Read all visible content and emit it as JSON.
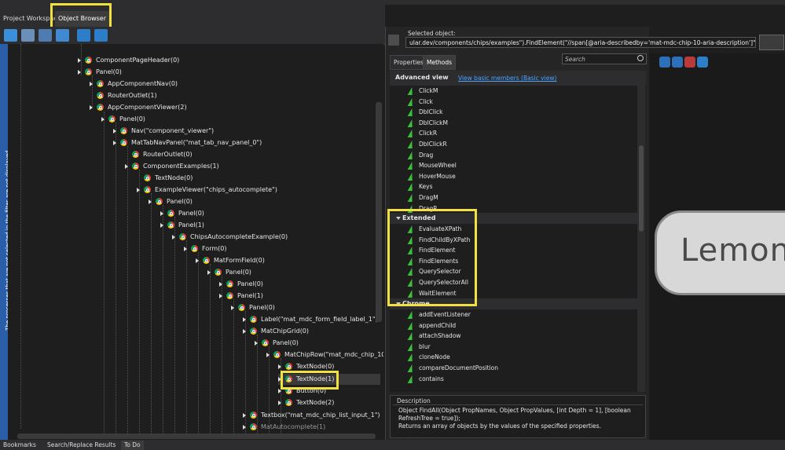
{
  "tabs": {
    "project_workspace": "Project Workspace",
    "object_browser": "Object Browser"
  },
  "side_message": "The processes that are not selected in the filter are not displayed.",
  "tree": [
    {
      "label": "ComponentPageHeader(0)"
    },
    {
      "label": "Panel(0)"
    },
    {
      "label": "AppComponentNav(0)"
    },
    {
      "label": "RouterOutlet(1)"
    },
    {
      "label": "AppComponentViewer(2)"
    },
    {
      "label": "Panel(0)"
    },
    {
      "label": "Nav(\"component_viewer\")"
    },
    {
      "label": "MatTabNavPanel(\"mat_tab_nav_panel_0\")"
    },
    {
      "label": "RouterOutlet(0)"
    },
    {
      "label": "ComponentExamples(1)"
    },
    {
      "label": "TextNode(0)"
    },
    {
      "label": "ExampleViewer(\"chips_autocomplete\")"
    },
    {
      "label": "Panel(0)"
    },
    {
      "label": "Panel(0)"
    },
    {
      "label": "Panel(1)"
    },
    {
      "label": "ChipsAutocompleteExample(0)"
    },
    {
      "label": "Form(0)"
    },
    {
      "label": "MatFormField(0)"
    },
    {
      "label": "Panel(0)"
    },
    {
      "label": "Panel(0)"
    },
    {
      "label": "Panel(1)"
    },
    {
      "label": "Panel(0)"
    },
    {
      "label": "Label(\"mat_mdc_form_field_label_1\")"
    },
    {
      "label": "MatChipGrid(0)"
    },
    {
      "label": "Panel(0)"
    },
    {
      "label": "MatChipRow(\"mat_mdc_chip_10"
    },
    {
      "label": "TextNode(0)"
    },
    {
      "label": "TextNode(1)"
    },
    {
      "label": "Button(0)"
    },
    {
      "label": "TextNode(2)"
    },
    {
      "label": "Textbox(\"mat_mdc_chip_list_input_1\")"
    },
    {
      "label": "MatAutocomplete(1)"
    }
  ],
  "bottom_tabs": [
    "Bookmarks",
    "Search/Replace Results",
    "To Do"
  ],
  "selected_object": {
    "label": "Selected object:",
    "value": "ular.dev/components/chips/examples\").FindElement(\"//span[@aria-describedby='mat-mdc-chip-10-aria-description']\").FindAll()"
  },
  "panel_tabs": {
    "properties": "Properties",
    "methods": "Methods"
  },
  "search": {
    "placeholder": "Search"
  },
  "advanced_view": {
    "title": "Advanced view",
    "link": "View basic members (Basic view)"
  },
  "methods_top": [
    "ClickM",
    "Click",
    "DblClick",
    "DblClickM",
    "ClickR",
    "DblClickR",
    "Drag",
    "MouseWheel",
    "HoverMouse",
    "Keys",
    "DragM",
    "DragR"
  ],
  "extended_group": {
    "label": "Extended",
    "methods": [
      "EvaluateXPath",
      "FindChildByXPath",
      "FindElement",
      "FindElements",
      "QuerySelector",
      "QuerySelectorAll",
      "WaitElement"
    ]
  },
  "chrome_group": {
    "label": "Chrome",
    "methods": [
      "addEventListener",
      "appendChild",
      "attachShadow",
      "blur",
      "cloneNode",
      "compareDocumentPosition",
      "contains"
    ]
  },
  "description": {
    "title": "Description",
    "text": "Object FindAll(Object PropNames, Object PropValues, [int Depth = 1], [boolean RefreshTree = true]);\nReturns an array of objects by the values of the specified properties."
  },
  "preview": {
    "text": "Lemon"
  },
  "colors": {
    "highlight": "#f0e040",
    "accent": "#2a5ea8",
    "link": "#4aa3ff",
    "method_icon": "#3bbf3b"
  }
}
